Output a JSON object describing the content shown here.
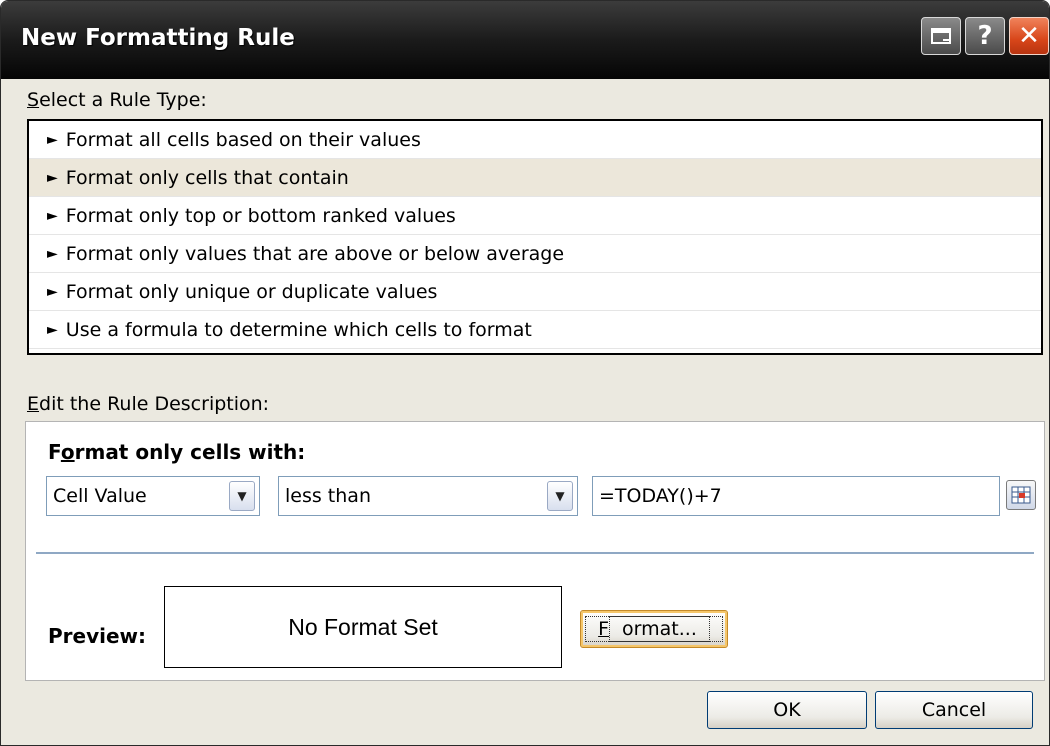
{
  "window": {
    "title": "New Formatting Rule",
    "help_glyph": "?",
    "close_glyph": "✕"
  },
  "rule_type": {
    "label": "Select a Rule Type:",
    "accesskey": "S",
    "label_rest": "elect a Rule Type:",
    "items": [
      {
        "label": "Format all cells based on their values",
        "selected": false
      },
      {
        "label": "Format only cells that contain",
        "selected": true
      },
      {
        "label": "Format only top or bottom ranked values",
        "selected": false
      },
      {
        "label": "Format only values that are above or below average",
        "selected": false
      },
      {
        "label": "Format only unique or duplicate values",
        "selected": false
      },
      {
        "label": "Use a formula to determine which cells to format",
        "selected": false
      }
    ],
    "arrow_glyph": "►"
  },
  "rule_description": {
    "label": "Edit the Rule Description:",
    "accesskey": "E",
    "label_rest": "dit the Rule Description:",
    "heading_pre": "F",
    "heading_accesskey": "o",
    "heading_post": "rmat only cells with:",
    "condition_type": "Cell Value",
    "operator": "less than",
    "value": "=TODAY()+7",
    "preview_label": "Preview:",
    "preview_text": "No Format Set",
    "format_button_accesskey": "F",
    "format_button_rest": "ormat..."
  },
  "buttons": {
    "ok": "OK",
    "cancel": "Cancel"
  },
  "colors": {
    "titlebar": "#1b1b1b",
    "dialog_bg": "#ebe9e0",
    "selected_row": "#ece7da",
    "close_button": "#d8461a"
  }
}
